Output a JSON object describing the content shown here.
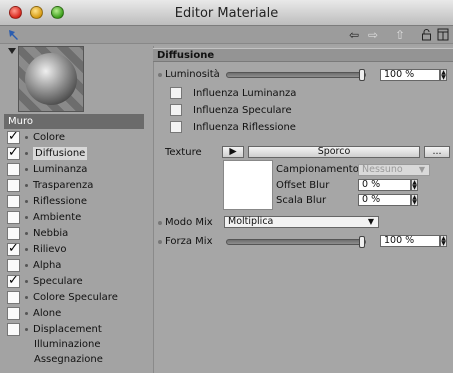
{
  "window": {
    "title": "Editor Materiale"
  },
  "toolbar": {
    "icons": [
      "pin-icon",
      "back-arrow-icon",
      "forward-arrow-icon",
      "up-arrow-icon",
      "lock-icon",
      "layout-icon"
    ]
  },
  "material": {
    "name": "Muro"
  },
  "channels": [
    {
      "label": "Colore",
      "checked": true
    },
    {
      "label": "Diffusione",
      "checked": true,
      "selected": true
    },
    {
      "label": "Luminanza",
      "checked": false
    },
    {
      "label": "Trasparenza",
      "checked": false
    },
    {
      "label": "Riflessione",
      "checked": false
    },
    {
      "label": "Ambiente",
      "checked": false
    },
    {
      "label": "Nebbia",
      "checked": false
    },
    {
      "label": "Rilievo",
      "checked": true
    },
    {
      "label": "Alpha",
      "checked": false
    },
    {
      "label": "Speculare",
      "checked": true
    },
    {
      "label": "Colore Speculare",
      "checked": false
    },
    {
      "label": "Alone",
      "checked": false
    },
    {
      "label": "Displacement",
      "checked": false
    }
  ],
  "extra_items": [
    "Illuminazione",
    "Assegnazione"
  ],
  "panel": {
    "title": "Diffusione",
    "luminosita": {
      "label": "Luminosità",
      "value": "100 %",
      "level": 1.0
    },
    "checkboxes": [
      "Influenza Luminanza",
      "Influenza Speculare",
      "Influenza Riflessione"
    ],
    "texture": {
      "label": "Texture",
      "play": "▶",
      "name": "Sporco",
      "more": "...",
      "campionamento_label": "Campionamento",
      "campionamento_value": "Nessuno",
      "offset_label": "Offset Blur",
      "offset_value": "0 %",
      "scala_label": "Scala Blur",
      "scala_value": "0 %"
    },
    "modo_mix": {
      "label": "Modo Mix",
      "value": "Moltiplica"
    },
    "forza_mix": {
      "label": "Forza Mix",
      "value": "100 %",
      "level": 1.0
    }
  }
}
